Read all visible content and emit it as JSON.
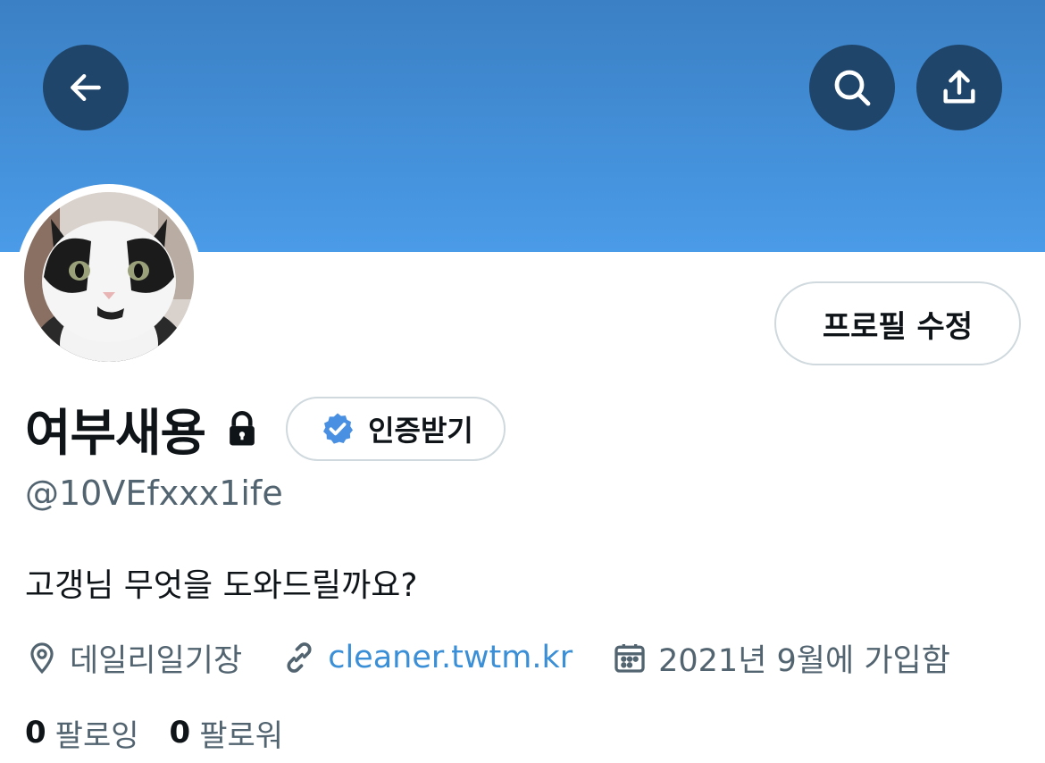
{
  "header": {
    "back_icon": "arrow-left-icon",
    "search_icon": "search-icon",
    "share_icon": "share-icon",
    "banner_color": "#4a9be8",
    "button_color": "#1f456b"
  },
  "profile": {
    "avatar_description_icon": "avatar",
    "edit_button_label": "프로필 수정",
    "display_name": "여부새용",
    "verify_button_label": "인증받기",
    "verified_color": "#4a90e2",
    "handle": "@10VEfxxx1ife",
    "bio": "고갱님 무엇을 도와드릴까요?",
    "location": "데일리일기장",
    "website": "cleaner.twtm.kr",
    "joined": "2021년 9월에 가입함",
    "following_count": "0",
    "following_label": "팔로잉",
    "followers_count": "0",
    "followers_label": "팔로워"
  }
}
